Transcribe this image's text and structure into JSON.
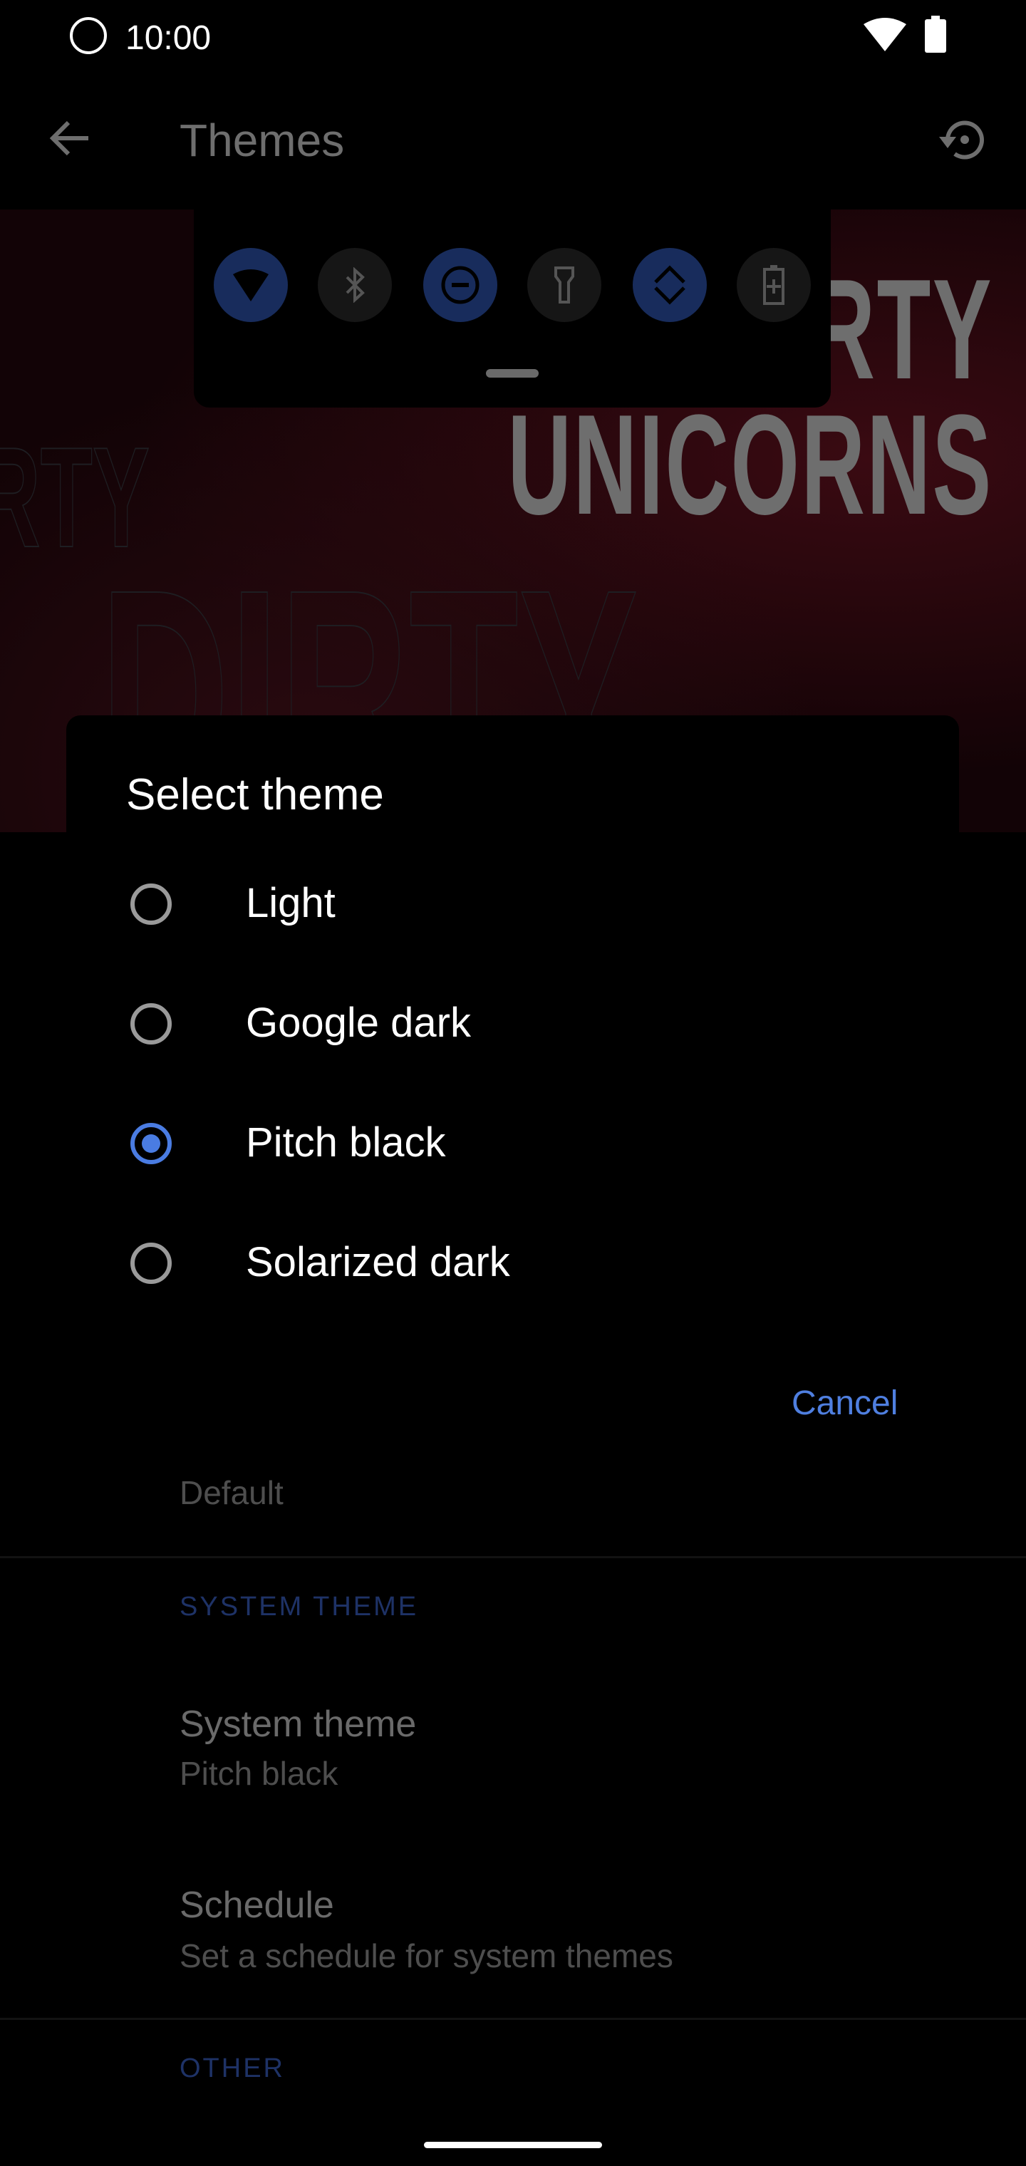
{
  "status_bar": {
    "time": "10:00",
    "icons": [
      "app-logo-icon",
      "wifi-icon",
      "battery-icon"
    ]
  },
  "toolbar": {
    "title": "Themes",
    "back_icon": "arrow-left-icon",
    "reset_icon": "restore-icon"
  },
  "preview": {
    "text_lines": [
      "RTY",
      "UNICORNS"
    ],
    "quick_tiles": [
      {
        "icon": "wifi-icon",
        "active": true
      },
      {
        "icon": "bluetooth-icon",
        "active": false
      },
      {
        "icon": "do-not-disturb-icon",
        "active": true
      },
      {
        "icon": "flashlight-icon",
        "active": false
      },
      {
        "icon": "auto-rotate-icon",
        "active": true
      },
      {
        "icon": "battery-saver-icon",
        "active": false
      }
    ]
  },
  "dialog": {
    "title": "Select theme",
    "options": [
      {
        "label": "Light",
        "selected": false
      },
      {
        "label": "Google dark",
        "selected": false
      },
      {
        "label": "Pitch black",
        "selected": true
      },
      {
        "label": "Solarized dark",
        "selected": false
      }
    ],
    "cancel_label": "Cancel",
    "accent": "#4a7ce2"
  },
  "settings": {
    "default_summary": "Default",
    "system_theme_category": "SYSTEM THEME",
    "system_theme": {
      "title": "System theme",
      "summary": "Pitch black"
    },
    "schedule": {
      "title": "Schedule",
      "summary": "Set a schedule for system themes"
    },
    "other_category": "OTHER"
  }
}
